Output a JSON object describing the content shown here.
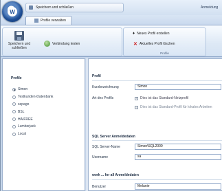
{
  "titlebar": {
    "qat_label": "Speichern und schließen",
    "title": "Anmeldung"
  },
  "tabs": [
    {
      "label": "Profile verwalten"
    }
  ],
  "ribbon": {
    "save_label": "Speichern und schließen",
    "connection_test_label": "Verbindung testen",
    "new_profile_label": "Neues Profil erstellen",
    "delete_profile_label": "Aktuelles Profil löschen",
    "group_label": "Profile"
  },
  "left_panel": {
    "title": "Profile",
    "profiles": [
      {
        "name": "Simon",
        "selected": true
      },
      {
        "name": "Testkunden-Datenbank",
        "selected": false
      },
      {
        "name": "sepago",
        "selected": false
      },
      {
        "name": "BSL",
        "selected": false
      },
      {
        "name": "HAIFREE",
        "selected": false
      },
      {
        "name": "Lumberjack",
        "selected": false
      },
      {
        "name": "Local",
        "selected": false
      }
    ]
  },
  "profile_section": {
    "title": "Profil",
    "short_name_label": "Kurzbezeichnung",
    "short_name_value": "Simon",
    "type_label": "Art des Profils",
    "check_network_label": "Dies ist das Standard-Netzprofil",
    "check_network_checked": true,
    "check_local_label": "Dies ist das Standard-Profil für lokales Arbeiten",
    "check_local_checked": false
  },
  "sql_section": {
    "title": "SQL Server Anmeldedaten",
    "server_label": "SQL Server-Name",
    "server_value": "Simon\\SQL2000",
    "user_label": "Username",
    "user_value": "sa"
  },
  "work_section": {
    "title": "work ... for all Anmeldedaten",
    "user_label": "Benutzer",
    "user_value": "Melanie"
  }
}
